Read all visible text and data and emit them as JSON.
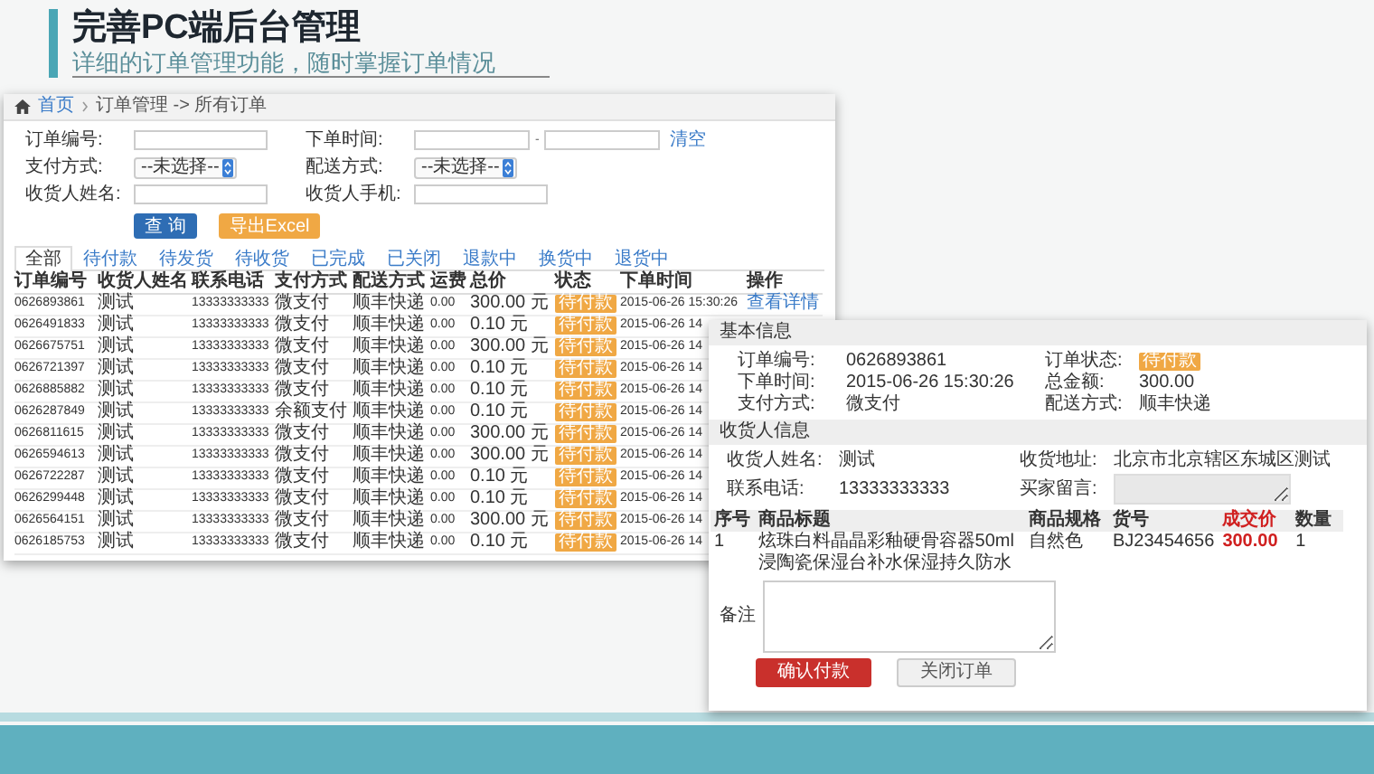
{
  "slide": {
    "title": "完善PC端后台管理",
    "subtitle": "详细的订单管理功能，随时掌握订单情况"
  },
  "order_list": {
    "breadcrumb": {
      "home": "首页",
      "path": "订单管理 -> 所有订单"
    },
    "filters": [
      {
        "kind": "input",
        "label": "订单编号:"
      },
      {
        "kind": "range",
        "label": "下单时间:",
        "separator": "-",
        "link": "清空"
      },
      {
        "kind": "select",
        "label": "支付方式:",
        "value": "--未选择--"
      },
      {
        "kind": "select",
        "label": "配送方式:",
        "value": "--未选择--"
      },
      {
        "kind": "input",
        "label": "收货人姓名:"
      },
      {
        "kind": "input",
        "label": "收货人手机:"
      }
    ],
    "buttons": [
      {
        "label": "查 询",
        "kind": "primary"
      },
      {
        "label": "导出Excel",
        "kind": "warning"
      }
    ],
    "tabs": [
      {
        "label": "全部",
        "selected": true
      },
      {
        "label": "待付款",
        "selected": false
      },
      {
        "label": "待发货",
        "selected": false
      },
      {
        "label": "待收货",
        "selected": false
      },
      {
        "label": "已完成",
        "selected": false
      },
      {
        "label": "已关闭",
        "selected": false
      },
      {
        "label": "退款中",
        "selected": false
      },
      {
        "label": "换货中",
        "selected": false
      },
      {
        "label": "退货中",
        "selected": false
      }
    ],
    "columns": [
      "订单编号",
      "收货人姓名",
      "联系电话",
      "支付方式",
      "配送方式",
      "运费",
      "总价",
      "状态",
      "下单时间",
      "操作"
    ],
    "rows": [
      {
        "order_no": "0626893861",
        "name": "测试",
        "phone": "13333333333",
        "payment": "微支付",
        "shipping": "顺丰快递",
        "freight": "0.00",
        "total": "300.00 元",
        "status": "待付款",
        "time": "2015-06-26 15:30:26",
        "action": "查看详情"
      },
      {
        "order_no": "0626491833",
        "name": "测试",
        "phone": "13333333333",
        "payment": "微支付",
        "shipping": "顺丰快递",
        "freight": "0.00",
        "total": "0.10 元",
        "status": "待付款",
        "time": "2015-06-26 14"
      },
      {
        "order_no": "0626675751",
        "name": "测试",
        "phone": "13333333333",
        "payment": "微支付",
        "shipping": "顺丰快递",
        "freight": "0.00",
        "total": "300.00 元",
        "status": "待付款",
        "time": "2015-06-26 14"
      },
      {
        "order_no": "0626721397",
        "name": "测试",
        "phone": "13333333333",
        "payment": "微支付",
        "shipping": "顺丰快递",
        "freight": "0.00",
        "total": "0.10 元",
        "status": "待付款",
        "time": "2015-06-26 14"
      },
      {
        "order_no": "0626885882",
        "name": "测试",
        "phone": "13333333333",
        "payment": "微支付",
        "shipping": "顺丰快递",
        "freight": "0.00",
        "total": "0.10 元",
        "status": "待付款",
        "time": "2015-06-26 14"
      },
      {
        "order_no": "0626287849",
        "name": "测试",
        "phone": "13333333333",
        "payment": "余额支付",
        "shipping": "顺丰快递",
        "freight": "0.00",
        "total": "0.10 元",
        "status": "待付款",
        "time": "2015-06-26 14"
      },
      {
        "order_no": "0626811615",
        "name": "测试",
        "phone": "13333333333",
        "payment": "微支付",
        "shipping": "顺丰快递",
        "freight": "0.00",
        "total": "300.00 元",
        "status": "待付款",
        "time": "2015-06-26 14"
      },
      {
        "order_no": "0626594613",
        "name": "测试",
        "phone": "13333333333",
        "payment": "微支付",
        "shipping": "顺丰快递",
        "freight": "0.00",
        "total": "300.00 元",
        "status": "待付款",
        "time": "2015-06-26 14"
      },
      {
        "order_no": "0626722287",
        "name": "测试",
        "phone": "13333333333",
        "payment": "微支付",
        "shipping": "顺丰快递",
        "freight": "0.00",
        "total": "0.10 元",
        "status": "待付款",
        "time": "2015-06-26 14"
      },
      {
        "order_no": "0626299448",
        "name": "测试",
        "phone": "13333333333",
        "payment": "微支付",
        "shipping": "顺丰快递",
        "freight": "0.00",
        "total": "0.10 元",
        "status": "待付款",
        "time": "2015-06-26 14"
      },
      {
        "order_no": "0626564151",
        "name": "测试",
        "phone": "13333333333",
        "payment": "微支付",
        "shipping": "顺丰快递",
        "freight": "0.00",
        "total": "300.00 元",
        "status": "待付款",
        "time": "2015-06-26 14"
      },
      {
        "order_no": "0626185753",
        "name": "测试",
        "phone": "13333333333",
        "payment": "微支付",
        "shipping": "顺丰快递",
        "freight": "0.00",
        "total": "0.10 元",
        "status": "待付款",
        "time": "2015-06-26 14"
      }
    ]
  },
  "detail": {
    "basic": {
      "title": "基本信息",
      "fields": [
        {
          "label": "订单编号:",
          "value": "0626893861",
          "kind": "text"
        },
        {
          "label": "订单状态:",
          "value": "待付款",
          "kind": "badge"
        },
        {
          "label": "下单时间:",
          "value": "2015-06-26 15:30:26",
          "kind": "text"
        },
        {
          "label": "总金额:",
          "value": "300.00",
          "kind": "text"
        },
        {
          "label": "支付方式:",
          "value": "微支付",
          "kind": "text"
        },
        {
          "label": "配送方式:",
          "value": "顺丰快递",
          "kind": "text"
        }
      ]
    },
    "consignee": {
      "title": "收货人信息",
      "fields": [
        {
          "label": "收货人姓名:",
          "value": "测试",
          "kind": "text"
        },
        {
          "label": "收货地址:",
          "value": "北京市北京辖区东城区测试",
          "kind": "text"
        },
        {
          "label": "联系电话:",
          "value": "13333333333",
          "kind": "text"
        },
        {
          "label": "买家留言:",
          "kind": "textarea"
        }
      ]
    },
    "goods": {
      "columns": [
        {
          "label": "序号",
          "highlight": false
        },
        {
          "label": "商品标题",
          "highlight": false
        },
        {
          "label": "商品规格",
          "highlight": false
        },
        {
          "label": "货号",
          "highlight": false
        },
        {
          "label": "成交价",
          "highlight": true
        },
        {
          "label": "数量",
          "highlight": false
        }
      ],
      "rows": [
        {
          "cells": [
            "1",
            "炫珠白料晶晶彩釉硬骨容器50ml浸陶瓷保湿台补水保湿持久防水",
            "自然色",
            "BJ23454656",
            "300.00",
            "1"
          ]
        }
      ]
    },
    "remark": {
      "label": "备注"
    },
    "actions": [
      {
        "label": "确认付款",
        "kind": "primary"
      },
      {
        "label": "关闭订单",
        "kind": "default"
      }
    ]
  }
}
